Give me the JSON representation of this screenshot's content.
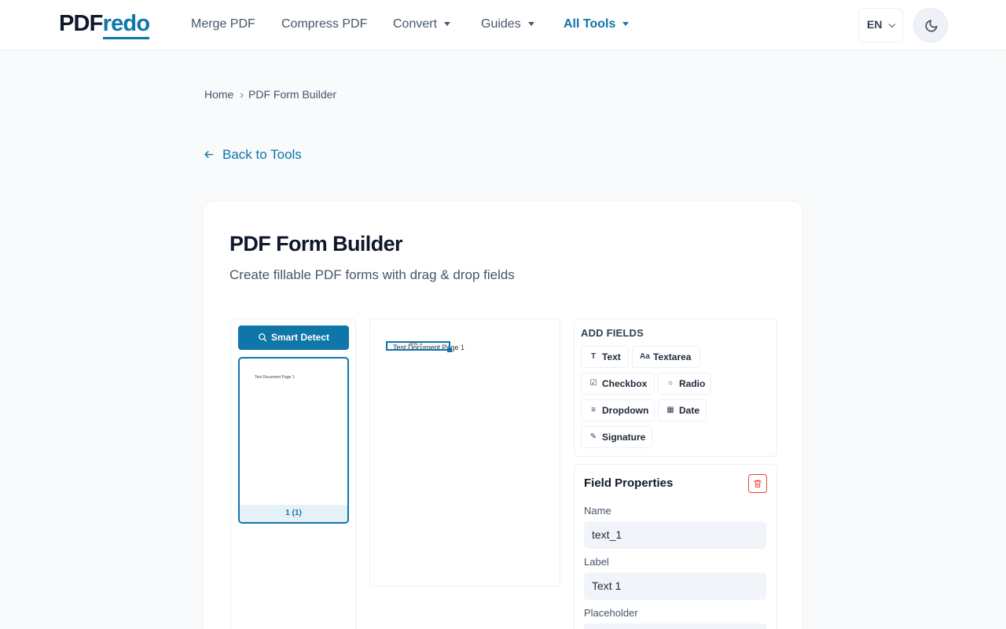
{
  "header": {
    "logo_part1": "PDF",
    "logo_part2": "redo",
    "nav": [
      {
        "label": "Merge PDF"
      },
      {
        "label": "Compress PDF"
      },
      {
        "label": "Convert"
      },
      {
        "label": "Guides"
      },
      {
        "label": "All Tools"
      }
    ],
    "language": "EN",
    "colors": {
      "accent": "#0e76a8",
      "text_dark": "#0f172a"
    }
  },
  "breadcrumb": {
    "home": "Home",
    "current": "PDF Form Builder"
  },
  "back_link": "Back to Tools",
  "card": {
    "title": "PDF Form Builder",
    "subtitle": "Create fillable PDF forms with drag & drop fields"
  },
  "pages_panel": {
    "smart_detect_label": "Smart Detect",
    "thumb_text": "Test Document Page 1",
    "thumb_label": "1 (1)"
  },
  "canvas": {
    "document_text": "Test Document Page 1",
    "field_label": "Text 1"
  },
  "add_fields": {
    "title": "ADD FIELDS",
    "items": [
      {
        "label": "Text",
        "icon": "text-type-icon"
      },
      {
        "label": "Textarea",
        "icon": "textarea-icon"
      },
      {
        "label": "Checkbox",
        "icon": "checkbox-icon"
      },
      {
        "label": "Radio",
        "icon": "radio-icon"
      },
      {
        "label": "Dropdown",
        "icon": "list-icon"
      },
      {
        "label": "Date",
        "icon": "calendar-icon"
      },
      {
        "label": "Signature",
        "icon": "pen-icon"
      }
    ]
  },
  "field_properties": {
    "title": "Field Properties",
    "name_label": "Name",
    "name_value": "text_1",
    "label_label": "Label",
    "label_value": "Text 1",
    "placeholder_label": "Placeholder"
  }
}
